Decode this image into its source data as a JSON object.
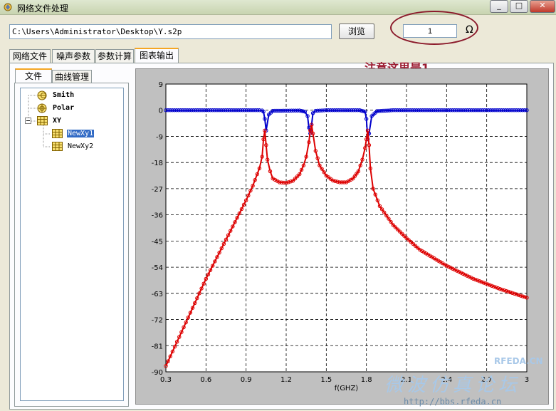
{
  "window": {
    "title": "网络文件处理",
    "minimize": "_",
    "maximize": "□",
    "close": "✕"
  },
  "toolbar": {
    "file_path": "C:\\Users\\Administrator\\Desktop\\Y.s2p",
    "browse_label": "浏览",
    "impedance_value": "1",
    "impedance_unit": "Ω"
  },
  "annotation": {
    "note": "注意这里是1",
    "ellipse_color": "#8b1a2b"
  },
  "tabs": [
    {
      "label": "网络文件",
      "active": false
    },
    {
      "label": "噪声参数",
      "active": false
    },
    {
      "label": "参数计算",
      "active": false
    },
    {
      "label": "图表输出",
      "active": true
    }
  ],
  "subtabs": [
    {
      "label": "文件",
      "active": true
    },
    {
      "label": "曲线管理",
      "active": false
    }
  ],
  "tree": {
    "items": [
      {
        "label": "Smith",
        "icon": "smith-chart-icon"
      },
      {
        "label": "Polar",
        "icon": "polar-chart-icon"
      },
      {
        "label": "XY",
        "icon": "xy-grid-icon",
        "expanded": true
      },
      {
        "label": "NewXy1",
        "icon": "xy-grid-icon",
        "selected": true
      },
      {
        "label": "NewXy2",
        "icon": "xy-grid-icon",
        "selected": false
      }
    ]
  },
  "chart_data": {
    "type": "line",
    "xlabel": "f(GHZ)",
    "ylabel": "",
    "xlim": [
      0.3,
      3.0
    ],
    "ylim": [
      -90,
      9
    ],
    "x_ticks": [
      0.3,
      0.6,
      0.9,
      1.2,
      1.5,
      1.8,
      2.1,
      2.4,
      2.7,
      3.0
    ],
    "x_tick_labels": [
      "0.3",
      "0.6",
      "0.9",
      "1.2",
      "1.5",
      "1.8",
      "2.1",
      "2.4",
      "2.7",
      "3"
    ],
    "y_ticks": [
      9,
      0,
      -9,
      -18,
      -27,
      -36,
      -45,
      -54,
      -63,
      -72,
      -81,
      -90
    ],
    "grid": true,
    "series": [
      {
        "color": "#0000cc",
        "marker": "circle",
        "x": [
          0.3,
          1.0,
          1.02,
          1.03,
          1.04,
          1.05,
          1.07,
          1.1,
          1.3,
          1.34,
          1.36,
          1.37,
          1.38,
          1.39,
          1.4,
          1.42,
          1.5,
          1.75,
          1.79,
          1.8,
          1.81,
          1.82,
          1.84,
          1.88,
          2.0,
          3.0
        ],
        "values": [
          0,
          0,
          -0.1,
          -0.5,
          -3,
          -7,
          -1.5,
          -0.2,
          -0.1,
          -0.5,
          -2,
          -6,
          -8,
          -5,
          -1,
          -0.2,
          0,
          0,
          -0.5,
          -3,
          -10,
          -8,
          -2,
          -0.3,
          0,
          0
        ]
      },
      {
        "color": "#dd0000",
        "marker": "circle",
        "x": [
          0.3,
          0.4,
          0.5,
          0.6,
          0.7,
          0.8,
          0.9,
          0.95,
          1.0,
          1.02,
          1.03,
          1.04,
          1.05,
          1.06,
          1.08,
          1.1,
          1.15,
          1.2,
          1.25,
          1.3,
          1.33,
          1.35,
          1.37,
          1.38,
          1.39,
          1.4,
          1.42,
          1.45,
          1.5,
          1.55,
          1.6,
          1.65,
          1.7,
          1.74,
          1.77,
          1.79,
          1.8,
          1.81,
          1.82,
          1.83,
          1.85,
          1.9,
          2.0,
          2.1,
          2.2,
          2.4,
          2.6,
          2.8,
          3.0
        ],
        "values": [
          -88,
          -78,
          -68,
          -58,
          -49,
          -40,
          -31,
          -26,
          -20,
          -16,
          -10,
          -7,
          -12,
          -17,
          -21,
          -23.5,
          -24.8,
          -25,
          -24.3,
          -22,
          -19,
          -16,
          -11,
          -7,
          -5,
          -8,
          -14,
          -19,
          -22.5,
          -24.2,
          -24.8,
          -24.8,
          -23.5,
          -21,
          -17,
          -13,
          -10,
          -7,
          -12,
          -20,
          -27,
          -33,
          -39.5,
          -44,
          -48,
          -53.5,
          -58,
          -61.5,
          -64.5
        ]
      }
    ]
  },
  "watermark": {
    "brand": "RFEDA.CN",
    "cn_text": "微波仿真论坛",
    "url": "http://bbs.rfeda.cn"
  }
}
